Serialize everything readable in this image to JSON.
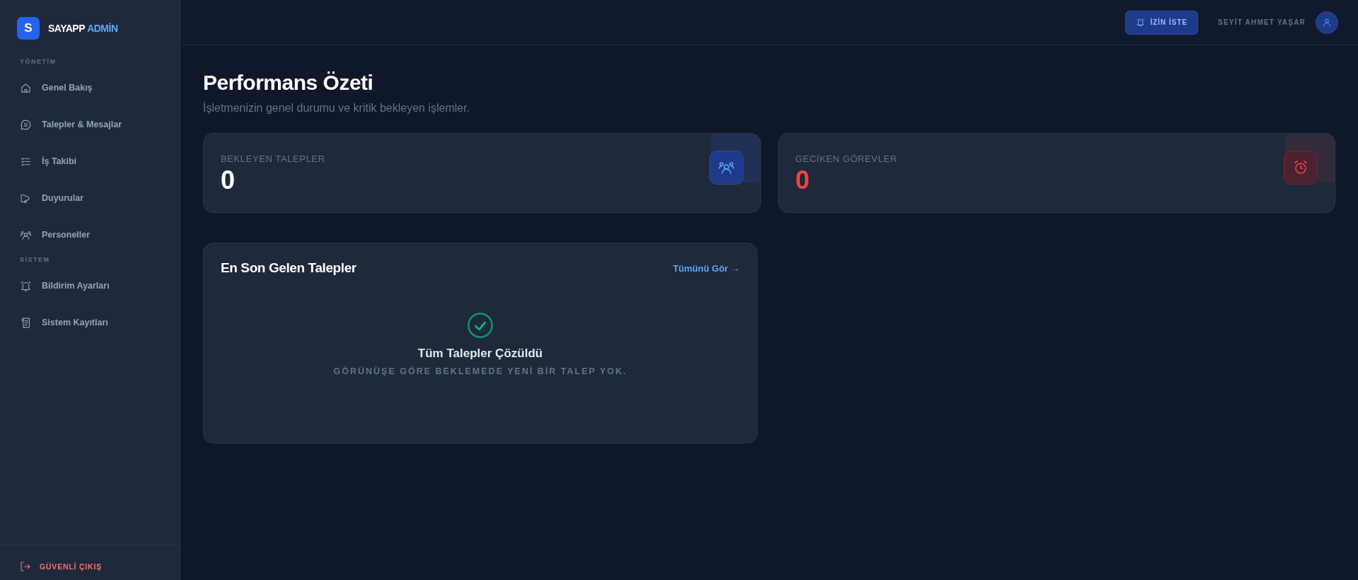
{
  "sidebar": {
    "logo": {
      "mark": "S",
      "name": "SAYAPP",
      "suffix": "ADMİN"
    },
    "sections": [
      {
        "title": "YÖNETİM",
        "items": [
          {
            "label": "Genel Bakış",
            "kind": "home"
          },
          {
            "label": "Talepler & Mesajlar",
            "kind": "chat"
          },
          {
            "label": "İş Takibi",
            "kind": "list"
          },
          {
            "label": "Duyurular",
            "kind": "megaphone"
          },
          {
            "label": "Personeller",
            "kind": "users"
          }
        ]
      },
      {
        "title": "SİSTEM",
        "items": [
          {
            "label": "Bildirim Ayarları",
            "kind": "bell"
          },
          {
            "label": "Sistem Kayıtları",
            "kind": "scroll"
          }
        ]
      }
    ],
    "logout": "GÜVENLİ ÇIKIŞ"
  },
  "header": {
    "leave_button": "İZİN İSTE",
    "user_name": "SEYİT AHMET YAŞAR"
  },
  "page": {
    "title": "Performans Özeti",
    "subtitle": "İşletmenizin genel durumu ve kritik bekleyen işlemler."
  },
  "stats": [
    {
      "label": "BEKLEYEN TALEPLER",
      "value": "0",
      "kind": "info"
    },
    {
      "label": "GECİKEN GÖREVLER",
      "value": "0",
      "kind": "danger"
    }
  ],
  "recent": {
    "title": "En Son Gelen Talepler",
    "link": "Tümünü Gör →",
    "empty_title": "Tüm Talepler Çözüldü",
    "empty_text": "GÖRÜNÜŞE GÖRE BEKLEMEDE YENİ BİR TALEP YOK."
  }
}
